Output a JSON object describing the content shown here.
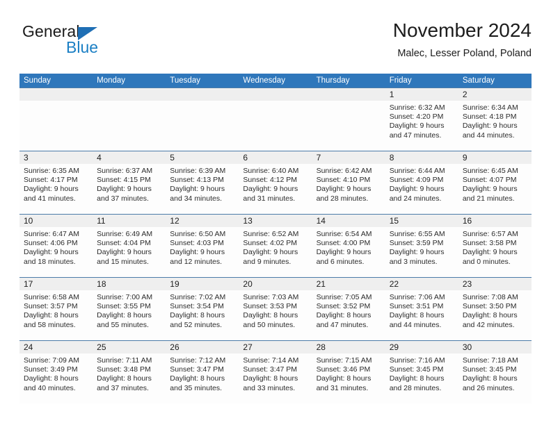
{
  "brand": {
    "name_part1": "General",
    "name_part2": "Blue",
    "triangle_color": "#1f6fb5",
    "blue_text_color": "#1b7fc4"
  },
  "header": {
    "title": "November 2024",
    "location": "Malec, Lesser Poland, Poland"
  },
  "theme": {
    "header_bar_color": "#2f77bb",
    "date_band_color": "#efefef",
    "week_divider_color": "#4b7ba8",
    "cell_background": "#fdfdfd"
  },
  "calendar": {
    "weekday_headers": [
      "Sunday",
      "Monday",
      "Tuesday",
      "Wednesday",
      "Thursday",
      "Friday",
      "Saturday"
    ],
    "labels": {
      "sunrise_prefix": "Sunrise:",
      "sunset_prefix": "Sunset:",
      "daylight_prefix": "Daylight:"
    },
    "weeks": [
      [
        {
          "day": "",
          "sunrise": "",
          "sunset": "",
          "daylight_line1": "",
          "daylight_line2": ""
        },
        {
          "day": "",
          "sunrise": "",
          "sunset": "",
          "daylight_line1": "",
          "daylight_line2": ""
        },
        {
          "day": "",
          "sunrise": "",
          "sunset": "",
          "daylight_line1": "",
          "daylight_line2": ""
        },
        {
          "day": "",
          "sunrise": "",
          "sunset": "",
          "daylight_line1": "",
          "daylight_line2": ""
        },
        {
          "day": "",
          "sunrise": "",
          "sunset": "",
          "daylight_line1": "",
          "daylight_line2": ""
        },
        {
          "day": "1",
          "sunrise": "Sunrise: 6:32 AM",
          "sunset": "Sunset: 4:20 PM",
          "daylight_line1": "Daylight: 9 hours",
          "daylight_line2": "and 47 minutes."
        },
        {
          "day": "2",
          "sunrise": "Sunrise: 6:34 AM",
          "sunset": "Sunset: 4:18 PM",
          "daylight_line1": "Daylight: 9 hours",
          "daylight_line2": "and 44 minutes."
        }
      ],
      [
        {
          "day": "3",
          "sunrise": "Sunrise: 6:35 AM",
          "sunset": "Sunset: 4:17 PM",
          "daylight_line1": "Daylight: 9 hours",
          "daylight_line2": "and 41 minutes."
        },
        {
          "day": "4",
          "sunrise": "Sunrise: 6:37 AM",
          "sunset": "Sunset: 4:15 PM",
          "daylight_line1": "Daylight: 9 hours",
          "daylight_line2": "and 37 minutes."
        },
        {
          "day": "5",
          "sunrise": "Sunrise: 6:39 AM",
          "sunset": "Sunset: 4:13 PM",
          "daylight_line1": "Daylight: 9 hours",
          "daylight_line2": "and 34 minutes."
        },
        {
          "day": "6",
          "sunrise": "Sunrise: 6:40 AM",
          "sunset": "Sunset: 4:12 PM",
          "daylight_line1": "Daylight: 9 hours",
          "daylight_line2": "and 31 minutes."
        },
        {
          "day": "7",
          "sunrise": "Sunrise: 6:42 AM",
          "sunset": "Sunset: 4:10 PM",
          "daylight_line1": "Daylight: 9 hours",
          "daylight_line2": "and 28 minutes."
        },
        {
          "day": "8",
          "sunrise": "Sunrise: 6:44 AM",
          "sunset": "Sunset: 4:09 PM",
          "daylight_line1": "Daylight: 9 hours",
          "daylight_line2": "and 24 minutes."
        },
        {
          "day": "9",
          "sunrise": "Sunrise: 6:45 AM",
          "sunset": "Sunset: 4:07 PM",
          "daylight_line1": "Daylight: 9 hours",
          "daylight_line2": "and 21 minutes."
        }
      ],
      [
        {
          "day": "10",
          "sunrise": "Sunrise: 6:47 AM",
          "sunset": "Sunset: 4:06 PM",
          "daylight_line1": "Daylight: 9 hours",
          "daylight_line2": "and 18 minutes."
        },
        {
          "day": "11",
          "sunrise": "Sunrise: 6:49 AM",
          "sunset": "Sunset: 4:04 PM",
          "daylight_line1": "Daylight: 9 hours",
          "daylight_line2": "and 15 minutes."
        },
        {
          "day": "12",
          "sunrise": "Sunrise: 6:50 AM",
          "sunset": "Sunset: 4:03 PM",
          "daylight_line1": "Daylight: 9 hours",
          "daylight_line2": "and 12 minutes."
        },
        {
          "day": "13",
          "sunrise": "Sunrise: 6:52 AM",
          "sunset": "Sunset: 4:02 PM",
          "daylight_line1": "Daylight: 9 hours",
          "daylight_line2": "and 9 minutes."
        },
        {
          "day": "14",
          "sunrise": "Sunrise: 6:54 AM",
          "sunset": "Sunset: 4:00 PM",
          "daylight_line1": "Daylight: 9 hours",
          "daylight_line2": "and 6 minutes."
        },
        {
          "day": "15",
          "sunrise": "Sunrise: 6:55 AM",
          "sunset": "Sunset: 3:59 PM",
          "daylight_line1": "Daylight: 9 hours",
          "daylight_line2": "and 3 minutes."
        },
        {
          "day": "16",
          "sunrise": "Sunrise: 6:57 AM",
          "sunset": "Sunset: 3:58 PM",
          "daylight_line1": "Daylight: 9 hours",
          "daylight_line2": "and 0 minutes."
        }
      ],
      [
        {
          "day": "17",
          "sunrise": "Sunrise: 6:58 AM",
          "sunset": "Sunset: 3:57 PM",
          "daylight_line1": "Daylight: 8 hours",
          "daylight_line2": "and 58 minutes."
        },
        {
          "day": "18",
          "sunrise": "Sunrise: 7:00 AM",
          "sunset": "Sunset: 3:55 PM",
          "daylight_line1": "Daylight: 8 hours",
          "daylight_line2": "and 55 minutes."
        },
        {
          "day": "19",
          "sunrise": "Sunrise: 7:02 AM",
          "sunset": "Sunset: 3:54 PM",
          "daylight_line1": "Daylight: 8 hours",
          "daylight_line2": "and 52 minutes."
        },
        {
          "day": "20",
          "sunrise": "Sunrise: 7:03 AM",
          "sunset": "Sunset: 3:53 PM",
          "daylight_line1": "Daylight: 8 hours",
          "daylight_line2": "and 50 minutes."
        },
        {
          "day": "21",
          "sunrise": "Sunrise: 7:05 AM",
          "sunset": "Sunset: 3:52 PM",
          "daylight_line1": "Daylight: 8 hours",
          "daylight_line2": "and 47 minutes."
        },
        {
          "day": "22",
          "sunrise": "Sunrise: 7:06 AM",
          "sunset": "Sunset: 3:51 PM",
          "daylight_line1": "Daylight: 8 hours",
          "daylight_line2": "and 44 minutes."
        },
        {
          "day": "23",
          "sunrise": "Sunrise: 7:08 AM",
          "sunset": "Sunset: 3:50 PM",
          "daylight_line1": "Daylight: 8 hours",
          "daylight_line2": "and 42 minutes."
        }
      ],
      [
        {
          "day": "24",
          "sunrise": "Sunrise: 7:09 AM",
          "sunset": "Sunset: 3:49 PM",
          "daylight_line1": "Daylight: 8 hours",
          "daylight_line2": "and 40 minutes."
        },
        {
          "day": "25",
          "sunrise": "Sunrise: 7:11 AM",
          "sunset": "Sunset: 3:48 PM",
          "daylight_line1": "Daylight: 8 hours",
          "daylight_line2": "and 37 minutes."
        },
        {
          "day": "26",
          "sunrise": "Sunrise: 7:12 AM",
          "sunset": "Sunset: 3:47 PM",
          "daylight_line1": "Daylight: 8 hours",
          "daylight_line2": "and 35 minutes."
        },
        {
          "day": "27",
          "sunrise": "Sunrise: 7:14 AM",
          "sunset": "Sunset: 3:47 PM",
          "daylight_line1": "Daylight: 8 hours",
          "daylight_line2": "and 33 minutes."
        },
        {
          "day": "28",
          "sunrise": "Sunrise: 7:15 AM",
          "sunset": "Sunset: 3:46 PM",
          "daylight_line1": "Daylight: 8 hours",
          "daylight_line2": "and 31 minutes."
        },
        {
          "day": "29",
          "sunrise": "Sunrise: 7:16 AM",
          "sunset": "Sunset: 3:45 PM",
          "daylight_line1": "Daylight: 8 hours",
          "daylight_line2": "and 28 minutes."
        },
        {
          "day": "30",
          "sunrise": "Sunrise: 7:18 AM",
          "sunset": "Sunset: 3:45 PM",
          "daylight_line1": "Daylight: 8 hours",
          "daylight_line2": "and 26 minutes."
        }
      ]
    ]
  }
}
